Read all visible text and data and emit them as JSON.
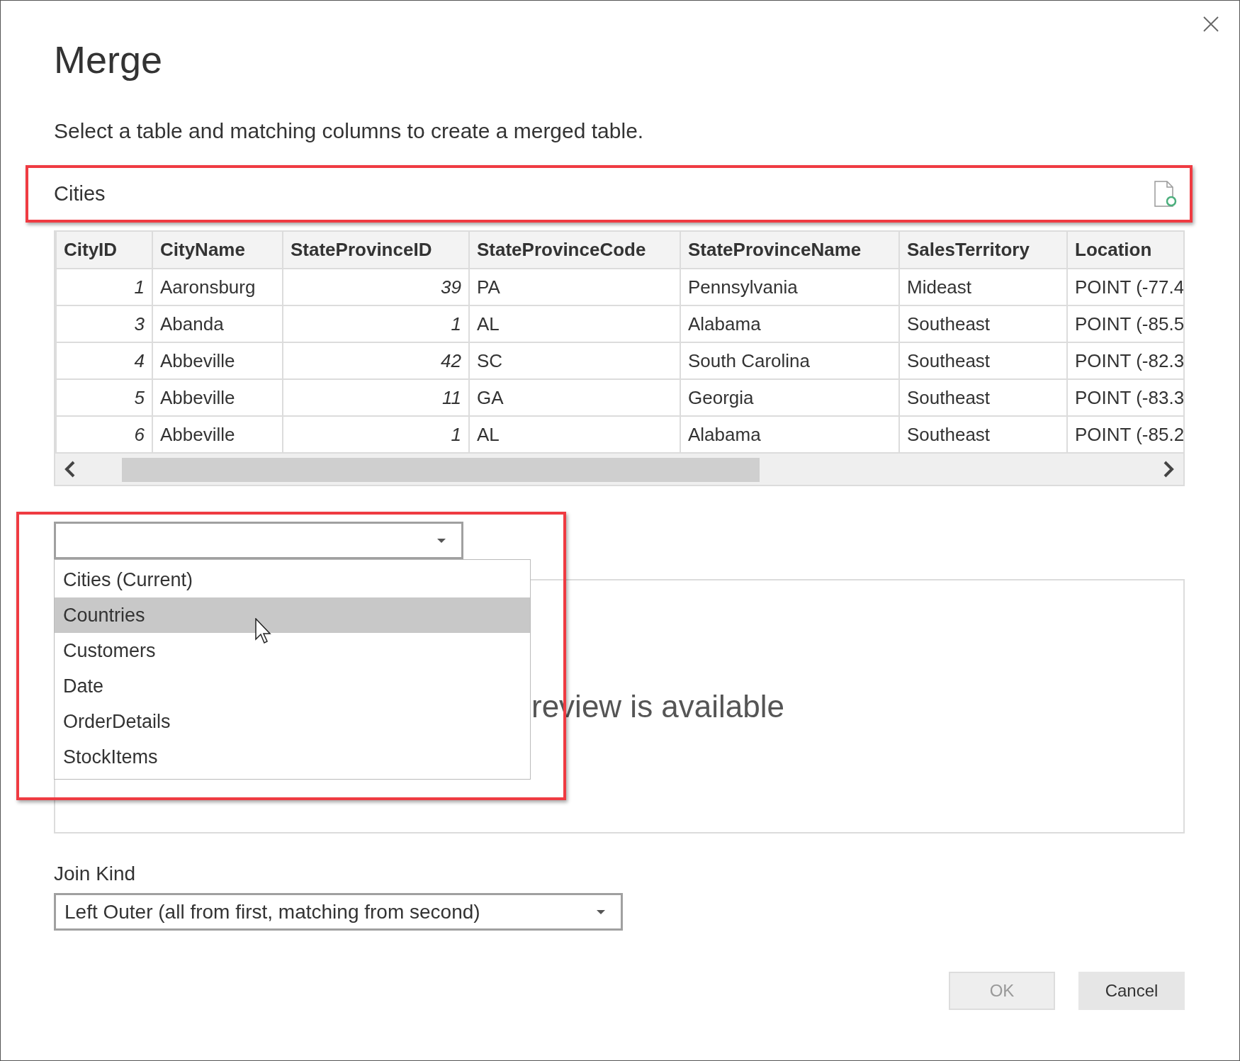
{
  "dialog": {
    "title": "Merge",
    "subtitle": "Select a table and matching columns to create a merged table."
  },
  "first_table": {
    "name": "Cities",
    "columns": [
      {
        "label": "CityID",
        "kind": "number"
      },
      {
        "label": "CityName",
        "kind": "text"
      },
      {
        "label": "StateProvinceID",
        "kind": "number"
      },
      {
        "label": "StateProvinceCode",
        "kind": "text"
      },
      {
        "label": "StateProvinceName",
        "kind": "text"
      },
      {
        "label": "SalesTerritory",
        "kind": "text"
      },
      {
        "label": "Location",
        "kind": "text"
      }
    ],
    "rows": [
      [
        "1",
        "Aaronsburg",
        "39",
        "PA",
        "Pennsylvania",
        "Mideast",
        "POINT (-77.4"
      ],
      [
        "3",
        "Abanda",
        "1",
        "AL",
        "Alabama",
        "Southeast",
        "POINT (-85.5"
      ],
      [
        "4",
        "Abbeville",
        "42",
        "SC",
        "South Carolina",
        "Southeast",
        "POINT (-82.3"
      ],
      [
        "5",
        "Abbeville",
        "11",
        "GA",
        "Georgia",
        "Southeast",
        "POINT (-83.3"
      ],
      [
        "6",
        "Abbeville",
        "1",
        "AL",
        "Alabama",
        "Southeast",
        "POINT (-85.2"
      ]
    ]
  },
  "second_table": {
    "expanded": true,
    "options": [
      {
        "label": "Cities (Current)",
        "selected": false
      },
      {
        "label": "Countries",
        "selected": true
      },
      {
        "label": "Customers",
        "selected": false
      },
      {
        "label": "Date",
        "selected": false
      },
      {
        "label": "OrderDetails",
        "selected": false
      },
      {
        "label": "StockItems",
        "selected": false
      }
    ],
    "preview_message": "review is available"
  },
  "join_kind": {
    "label": "Join Kind",
    "value": "Left Outer (all from first, matching from second)"
  },
  "buttons": [
    {
      "label": "OK",
      "disabled": true
    },
    {
      "label": "Cancel",
      "disabled": false
    }
  ]
}
